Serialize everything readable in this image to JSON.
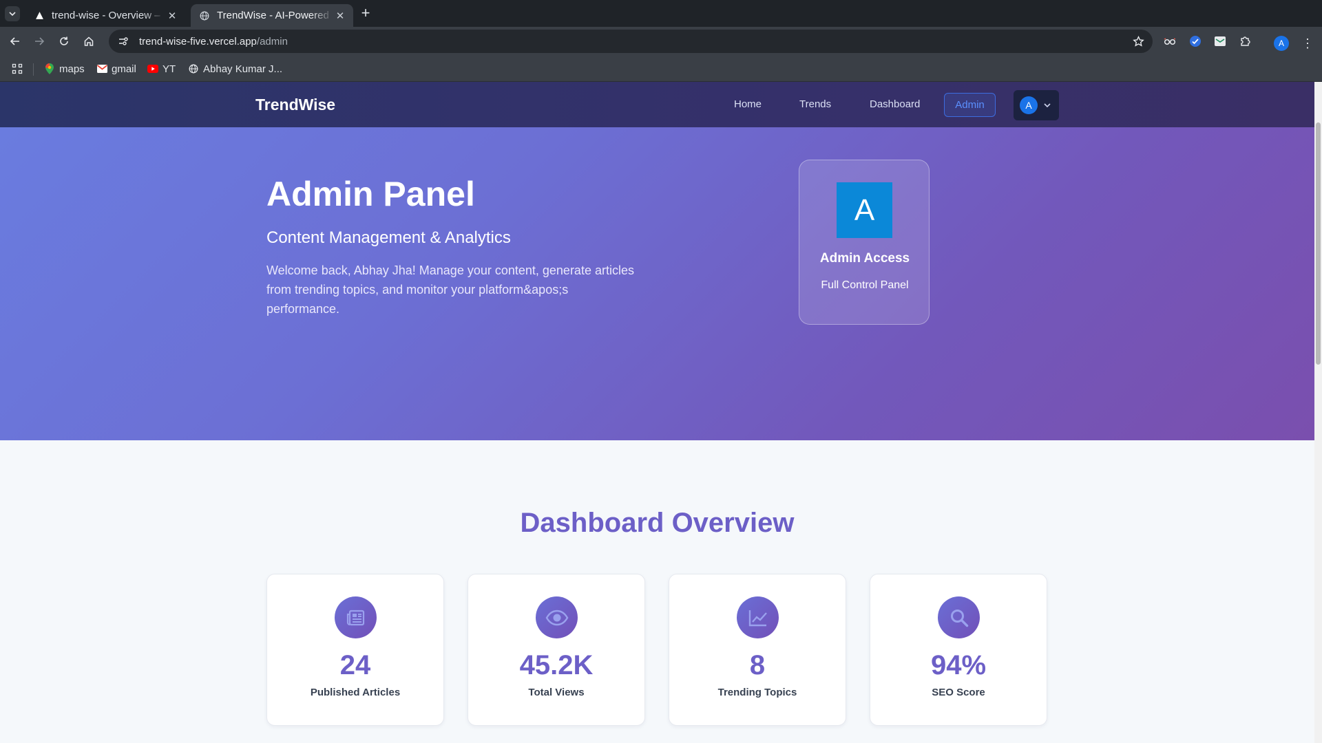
{
  "browser": {
    "tabs": [
      {
        "title": "trend-wise - Overview – ",
        "active": false
      },
      {
        "title": "TrendWise - AI-Powered",
        "active": true
      }
    ],
    "address": {
      "host": "trend-wise-five.vercel.app",
      "path": "/admin"
    },
    "profile_initial": "A",
    "bookmarks": [
      {
        "label": "maps",
        "icon": "maps-pin-icon"
      },
      {
        "label": "gmail",
        "icon": "gmail-icon"
      },
      {
        "label": "YT",
        "icon": "youtube-icon"
      },
      {
        "label": "Abhay Kumar J...",
        "icon": "globe-icon"
      }
    ]
  },
  "site": {
    "brand": "TrendWise",
    "nav": {
      "home": "Home",
      "trends": "Trends",
      "dashboard": "Dashboard",
      "admin": "Admin"
    },
    "user_initial": "A"
  },
  "hero": {
    "title": "Admin Panel",
    "subtitle": "Content Management & Analytics",
    "description": "Welcome back, Abhay Jha! Manage your content, generate articles from trending topics, and monitor your platform&apos;s performance.",
    "access_card": {
      "logo_letter": "A",
      "title": "Admin Access",
      "subtitle": "Full Control Panel"
    }
  },
  "overview": {
    "heading": "Dashboard Overview",
    "stats": [
      {
        "value": "24",
        "label": "Published Articles",
        "icon": "newspaper-icon"
      },
      {
        "value": "45.2K",
        "label": "Total Views",
        "icon": "eye-icon"
      },
      {
        "value": "8",
        "label": "Trending Topics",
        "icon": "trend-chart-icon"
      },
      {
        "value": "94%",
        "label": "SEO Score",
        "icon": "search-icon"
      }
    ]
  },
  "colors": {
    "accent": "#6c5fc7",
    "nav_bg": "#2b3569",
    "admin_link": "#5b90ff",
    "access_logo": "#0b88d8"
  }
}
